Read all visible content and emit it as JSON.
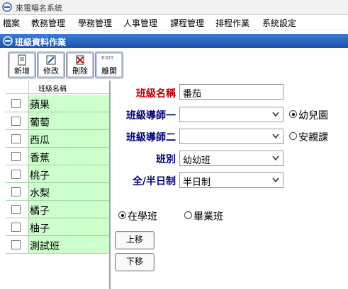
{
  "window": {
    "title": "來電唱名系統"
  },
  "menu": [
    "檔案",
    "教務管理",
    "學務管理",
    "人事管理",
    "課程管理",
    "排程作業",
    "系統設定"
  ],
  "panel": {
    "title": "班級資料作業"
  },
  "toolbar": {
    "new_label": "新增",
    "edit_label": "修改",
    "delete_label": "刪除",
    "exit_tag": "EXIT",
    "exit_label": "離開"
  },
  "list": {
    "header": "班級名稱",
    "items": [
      "蘋果",
      "葡萄",
      "西瓜",
      "香蕉",
      "桃子",
      "水梨",
      "橘子",
      "柚子",
      "測試班"
    ]
  },
  "form": {
    "class_name_label": "班級名稱",
    "class_name_value": "番茄",
    "teacher1_label": "班級導師一",
    "teacher1_value": "",
    "teacher2_label": "班級導師二",
    "teacher2_value": "",
    "category_label": "班別",
    "category_value": "幼幼班",
    "schedule_label": "全/半日制",
    "schedule_value": "半日制",
    "type_kindergarten": "幼兒園",
    "type_daycare": "安親課",
    "status_active": "在學班",
    "status_graduated": "畢業班",
    "move_up": "上移",
    "move_down": "下移"
  },
  "colors": {
    "list_row_bg": "#ccffcc",
    "label_blue": "#00007a",
    "label_red": "#c00000",
    "panel_bar": "#1d52a8"
  }
}
